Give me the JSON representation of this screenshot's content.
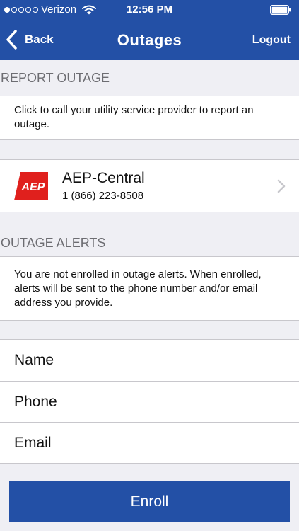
{
  "status_bar": {
    "carrier": "Verizon",
    "time": "12:56 PM",
    "signal_bars": 1,
    "signal_total": 5
  },
  "nav": {
    "back_label": "Back",
    "title": "Outages",
    "logout_label": "Logout"
  },
  "report_outage": {
    "header": "REPORT OUTAGE",
    "description": "Click to call your utility service provider to report an outage.",
    "provider": {
      "logo_text": "AEP",
      "name": "AEP-Central",
      "phone": "1 (866) 223-8508"
    }
  },
  "outage_alerts": {
    "header": "OUTAGE ALERTS",
    "description": "You are not enrolled in outage alerts. When enrolled, alerts will be sent to the phone number and/or email address you provide.",
    "fields": {
      "name_placeholder": "Name",
      "phone_placeholder": "Phone",
      "email_placeholder": "Email"
    },
    "enroll_label": "Enroll"
  },
  "icons": [
    "signal-icon",
    "wifi-icon",
    "battery-icon",
    "back-chevron-icon",
    "aep-logo",
    "chevron-right-icon"
  ],
  "colors": {
    "brand_blue": "#2350a6",
    "aep_red": "#e0201d",
    "background": "#efeff4",
    "header_text": "#6d6d72",
    "separator": "#c8c7cc"
  }
}
